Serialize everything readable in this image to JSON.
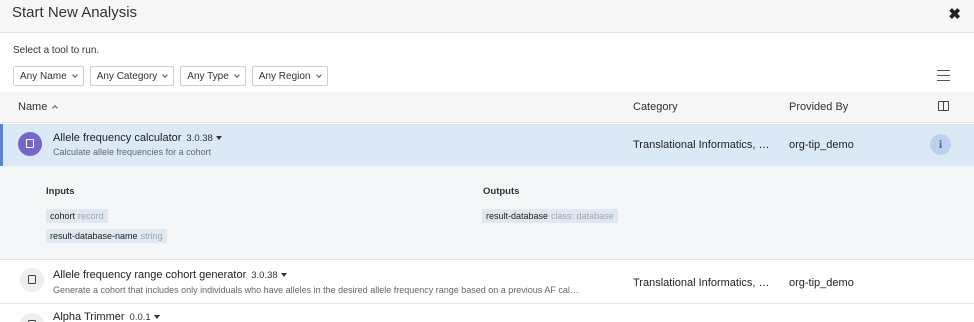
{
  "dialog": {
    "title": "Start New Analysis",
    "close_symbol": "✖"
  },
  "instruction": "Select a tool to run.",
  "filters": [
    {
      "label": "Any Name"
    },
    {
      "label": "Any Category"
    },
    {
      "label": "Any Type"
    },
    {
      "label": "Any Region"
    }
  ],
  "table": {
    "columns": {
      "name": "Name",
      "category": "Category",
      "provided_by": "Provided By"
    },
    "rows": [
      {
        "name": "Allele frequency calculator",
        "version": "3.0.38",
        "description": "Calculate allele frequencies for a cohort",
        "category": "Translational Informatics, …",
        "provided_by": "org-tip_demo",
        "info_symbol": "i"
      },
      {
        "name": "Allele frequency range cohort generator",
        "version": "3.0.38",
        "description": "Generate a cohort that includes only individuals who have alleles in the desired allele frequency range based on a previous AF cal…",
        "category": "Translational Informatics, …",
        "provided_by": "org-tip_demo"
      },
      {
        "name": "Alpha Trimmer",
        "version": "0.0.1"
      }
    ]
  },
  "details": {
    "inputs_title": "Inputs",
    "outputs_title": "Outputs",
    "inputs": [
      {
        "name": "cohort",
        "type": "record"
      },
      {
        "name": "result-database-name",
        "type": "string"
      }
    ],
    "outputs": [
      {
        "name": "result-database",
        "type": "class: database"
      }
    ]
  },
  "colors": {
    "selected_row": "#dbe9f7",
    "selected_border": "#5a86c4",
    "tool_icon": "#7767c4",
    "header_bg": "#f6f6f6"
  }
}
